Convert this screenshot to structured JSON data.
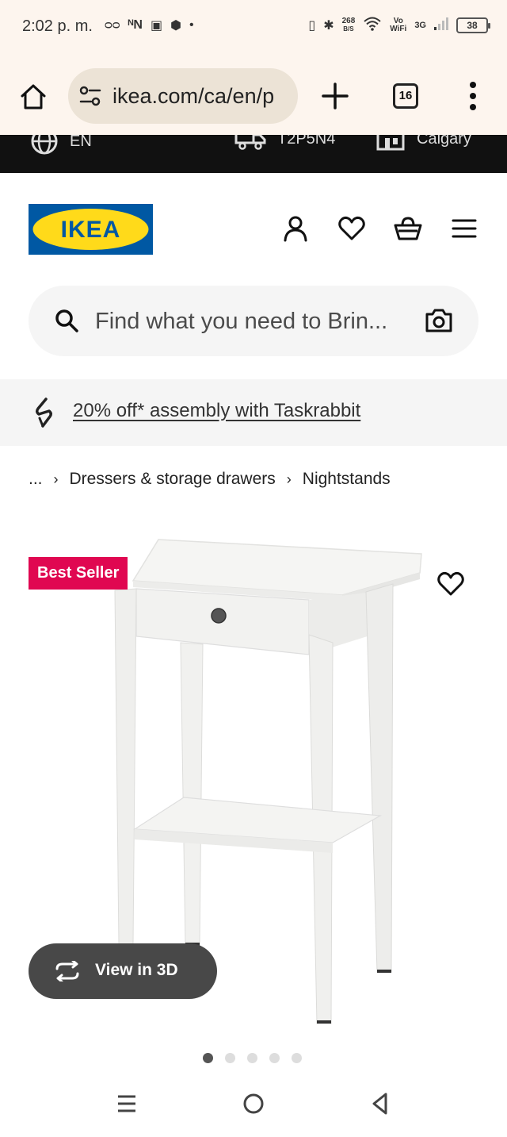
{
  "status_bar": {
    "time": "2:02 p. m.",
    "net_speed_value": "268",
    "net_speed_unit": "B/S",
    "vowifi_top": "Vo",
    "vowifi_bottom": "WiFi",
    "network": "3G",
    "battery": "38"
  },
  "browser": {
    "url": "ikea.com/ca/en/p",
    "tab_count": "16"
  },
  "top_bar": {
    "language": "EN",
    "postal_code": "T2P5N4",
    "store": "Calgary"
  },
  "header": {
    "logo_text": "IKEA"
  },
  "search": {
    "placeholder": "Find what you need to Brin..."
  },
  "promo": {
    "text": "20% off* assembly with Taskrabbit"
  },
  "breadcrumb": {
    "ellipsis": "...",
    "items": [
      "Dressers & storage drawers",
      "Nightstands"
    ]
  },
  "product": {
    "badge": "Best Seller",
    "view_3d_label": "View in 3D",
    "image_count": 5,
    "active_image": 1
  },
  "colors": {
    "ikea_blue": "#0058a3",
    "ikea_yellow": "#ffda1a",
    "badge_red": "#e00751",
    "view3d_bg": "#484848"
  }
}
